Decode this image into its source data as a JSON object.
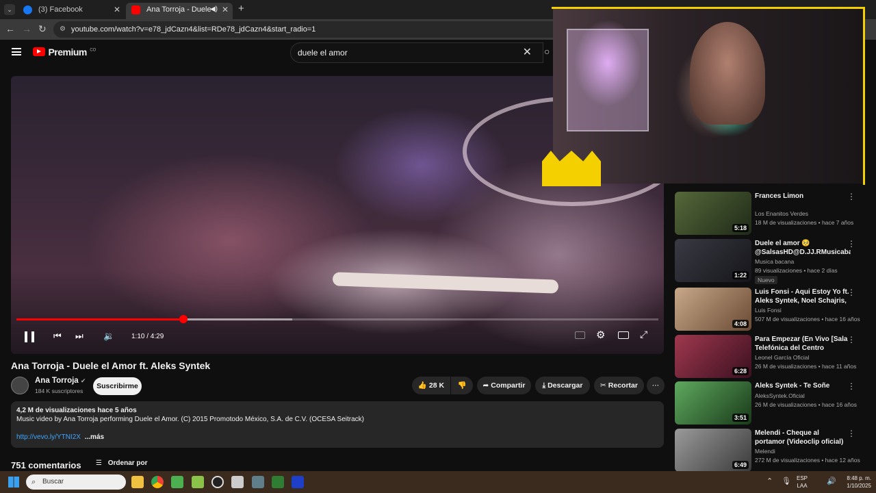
{
  "browser": {
    "tabs": [
      {
        "label": "(3) Facebook",
        "active": false
      },
      {
        "label": "Ana Torroja - Duele el Amor",
        "active": true
      }
    ],
    "url": "youtube.com/watch?v=e78_jdCazn4&list=RDe78_jdCazn4&start_radio=1"
  },
  "yt": {
    "logo_text": "Premium",
    "country": "CO",
    "search_value": "duele el amor"
  },
  "player": {
    "time": "1:10 / 4:29",
    "progress": 0.26,
    "buffered": 0.43
  },
  "video": {
    "title": "Ana Torroja - Duele el Amor ft. Aleks Syntek",
    "channel": "Ana Torroja",
    "subscribers": "184 K suscriptores",
    "subscribe_label": "Suscribirme",
    "likes": "28 K",
    "share_label": "Compartir",
    "download_label": "Descargar",
    "clip_label": "Recortar",
    "views_age": "4,2 M de visualizaciones  hace 5 años",
    "description": "Music video by Ana Torroja performing Duele el Amor. (C) 2015 Promotodo México, S.A. de C.V. (OCESA Seitrack)",
    "link": "http://vevo.ly/YTNI2X",
    "more": "...más",
    "comments_count": "751 comentarios",
    "sort_label": "Ordenar por"
  },
  "sidebar": {
    "items": [
      {
        "title": "Frances Limon",
        "channel": "Los Enanitos Verdes",
        "meta": "18 M de visualizaciones • hace 7 años",
        "duration": "5:18",
        "color": "#3a4a2a"
      },
      {
        "title": "Duele el amor 🥺 @SalsasHD@D.JJ.RMusicaba...",
        "channel": "Musica bacana",
        "meta": "89 visualizaciones • hace 2 días",
        "duration": "1:22",
        "badge": "Nuevo",
        "color": "#2a2a30"
      },
      {
        "title": "Luis Fonsi - Aqui Estoy Yo ft. Aleks Syntek, Noel Schajris, ...",
        "channel": "Luis Fonsi",
        "meta": "507 M de visualizaciones • hace 16 años",
        "duration": "4:08",
        "color": "#a08060"
      },
      {
        "title": "Para Empezar (En Vivo [Sala Telefónica del Centro Cultural ...",
        "channel": "Leonel García Oficial",
        "meta": "26 M de visualizaciones • hace 11 años",
        "duration": "6:28",
        "color": "#7a2a3a"
      },
      {
        "title": "Aleks Syntek - Te Soñe",
        "channel": "AleksSyntek.Oficial",
        "meta": "26 M de visualizaciones • hace 16 años",
        "duration": "3:51",
        "color": "#3a7a3a"
      },
      {
        "title": "Melendi - Cheque al portamor (Videoclip oficial)",
        "channel": "Melendi",
        "meta": "272 M de visualizaciones • hace 12 años",
        "duration": "6:49",
        "color": "#6a6a6a"
      }
    ]
  },
  "taskbar": {
    "search_placeholder": "Buscar",
    "lang": "ESP",
    "layout": "LAA",
    "time": "8:48 p. m.",
    "date": "1/10/2025"
  }
}
